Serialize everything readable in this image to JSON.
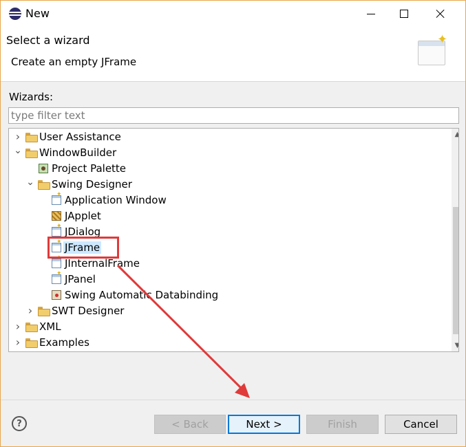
{
  "window": {
    "title": "New",
    "controls": {
      "minimize": "minimize-icon",
      "maximize": "maximize-icon",
      "close": "close-icon"
    }
  },
  "header": {
    "title": "Select a wizard",
    "description": "Create an empty JFrame"
  },
  "wizards_label": "Wizards:",
  "filter": {
    "placeholder": "type filter text",
    "value": ""
  },
  "tree": {
    "items": [
      {
        "label": "User Assistance",
        "expanded": false,
        "icon": "folder-icon"
      },
      {
        "label": "WindowBuilder",
        "expanded": true,
        "icon": "folder-icon"
      },
      {
        "label": "Project Palette",
        "icon": "palette-icon"
      },
      {
        "label": "Swing Designer",
        "expanded": true,
        "icon": "folder-icon"
      },
      {
        "label": "Application Window",
        "icon": "new-window-icon"
      },
      {
        "label": "JApplet",
        "icon": "applet-icon"
      },
      {
        "label": "JDialog",
        "icon": "new-window-icon"
      },
      {
        "label": "JFrame",
        "icon": "new-window-icon",
        "selected": true
      },
      {
        "label": "JInternalFrame",
        "icon": "new-window-icon"
      },
      {
        "label": "JPanel",
        "icon": "new-window-icon"
      },
      {
        "label": "Swing Automatic Databinding",
        "icon": "databinding-icon"
      },
      {
        "label": "SWT Designer",
        "expanded": false,
        "icon": "folder-icon"
      },
      {
        "label": "XML",
        "expanded": false,
        "icon": "folder-icon"
      },
      {
        "label": "Examples",
        "expanded": false,
        "icon": "folder-icon"
      }
    ]
  },
  "buttons": {
    "back": "< Back",
    "next": "Next >",
    "finish": "Finish",
    "cancel": "Cancel",
    "help": "?"
  },
  "colors": {
    "annotation": "#e03a3a",
    "selection": "#cde8ff",
    "default_button_border": "#0078d7"
  }
}
